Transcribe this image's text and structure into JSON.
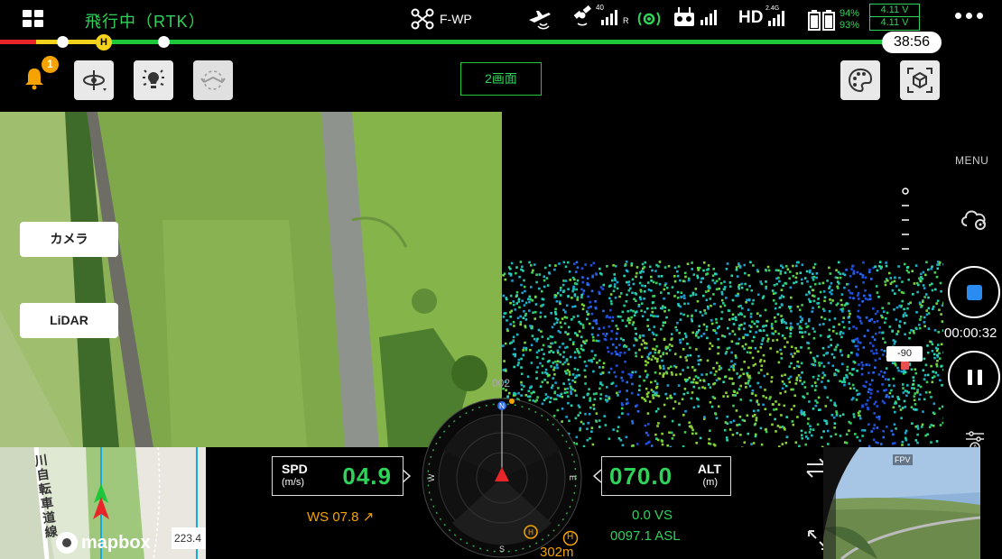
{
  "status_bar": {
    "flight_status": "飛行中（RTK）",
    "mode": "F-WP",
    "gps_count": "40",
    "gps_suffix": "R",
    "hd_band": "2.4G",
    "hd_label": "HD",
    "battery_pct_top": "94%",
    "battery_pct_bottom": "93%",
    "voltage_top": "4.11 V",
    "voltage_bottom": "4.11 V",
    "flight_time": "38:56",
    "progress_home_label": "H"
  },
  "toolbar": {
    "notification_count": "1",
    "split_view_label": "2画面"
  },
  "views": {
    "camera_label": "カメラ",
    "lidar_label": "LiDAR",
    "lidar_marker": "-90"
  },
  "right_rail": {
    "menu_label": "MENU",
    "record_time": "00:00:32"
  },
  "hud": {
    "speed_label": "SPD",
    "speed_unit": "(m/s)",
    "speed_value": "04.9",
    "wind_speed": "WS 07.8 ↗",
    "altitude_label": "ALT",
    "altitude_unit": "(m)",
    "altitude_value": "070.0",
    "vertical_speed": "0.0  VS",
    "asl": "0097.1 ASL",
    "compass_heading_label": "N",
    "compass_top_number": "002",
    "home_label": "H",
    "home_distance": "302m"
  },
  "minimap": {
    "road_label": "川自転車道線",
    "brand": "mapbox",
    "scale": "223.4"
  },
  "fpv": {
    "label": "FPV"
  },
  "colors": {
    "accent_green": "#2fd35a",
    "warning_orange": "#f5a300",
    "record_blue": "#2a8cf0",
    "progress_red": "#e8262a",
    "progress_yellow": "#f5d21b"
  }
}
